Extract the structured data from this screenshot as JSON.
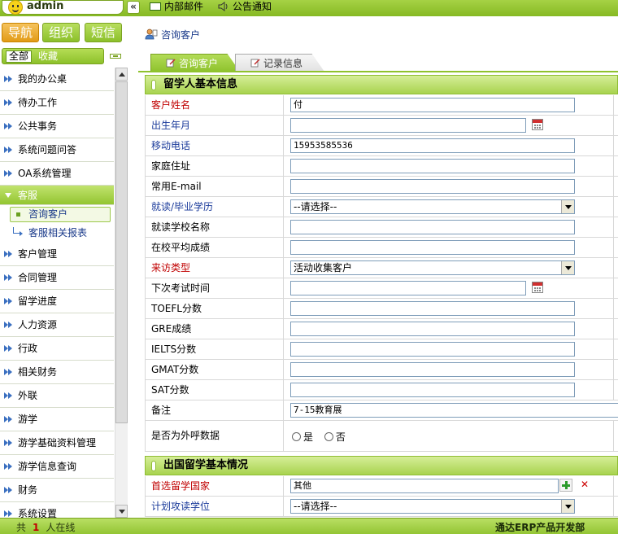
{
  "topbar": {
    "username": "admin",
    "collapse": "«",
    "mail_label": "内部邮件",
    "notice_label": "公告通知"
  },
  "sidebar": {
    "tabs": [
      "导航",
      "组织",
      "短信"
    ],
    "filter_all": "全部",
    "filter_fav": "收藏",
    "menu_top": [
      "我的办公桌",
      "待办工作",
      "公共事务",
      "系统问题问答",
      "OA系统管理"
    ],
    "open_group": "客服",
    "sub_items": [
      "咨询客户",
      "客服相关报表"
    ],
    "menu_bottom": [
      "客户管理",
      "合同管理",
      "留学进度",
      "人力资源",
      "行政",
      "相关财务",
      "外联",
      "游学",
      "游学基础资料管理",
      "游学信息查询",
      "财务",
      "系统设置"
    ]
  },
  "main": {
    "page_title": "咨询客户",
    "tabs": [
      "咨询客户",
      "记录信息"
    ],
    "section1_title": "留学人基本信息",
    "fields": [
      {
        "label": "客户姓名",
        "value": "付",
        "type": "text"
      },
      {
        "label": "出生年月",
        "value": "",
        "type": "date"
      },
      {
        "label": "移动电话",
        "value": "15953585536",
        "type": "text"
      },
      {
        "label": "家庭住址",
        "value": "",
        "type": "text"
      },
      {
        "label": "常用E-mail",
        "value": "",
        "type": "text"
      },
      {
        "label": "就读/毕业学历",
        "value": "--请选择--",
        "type": "select"
      },
      {
        "label": "就读学校名称",
        "value": "",
        "type": "text"
      },
      {
        "label": "在校平均成绩",
        "value": "",
        "type": "text"
      },
      {
        "label": "来访类型",
        "value": "活动收集客户",
        "type": "select"
      },
      {
        "label": "下次考试时间",
        "value": "",
        "type": "date"
      },
      {
        "label": "TOEFL分数",
        "value": "",
        "type": "text"
      },
      {
        "label": "GRE成绩",
        "value": "",
        "type": "text"
      },
      {
        "label": "IELTS分数",
        "value": "",
        "type": "text"
      },
      {
        "label": "GMAT分数",
        "value": "",
        "type": "text"
      },
      {
        "label": "SAT分数",
        "value": "",
        "type": "text"
      },
      {
        "label": "备注",
        "value": "7-15教育展",
        "type": "text"
      }
    ],
    "outbound_label": "是否为外呼数据",
    "radio_yes": "是",
    "radio_no": "否",
    "section2_title": "出国留学基本情况",
    "country_label": "首选留学国家",
    "country_value": "其他",
    "degree_label": "计划攻读学位",
    "degree_value": "--请选择--"
  },
  "status": {
    "prefix": "共",
    "count": "1",
    "suffix": "人在线",
    "brand": "通达ERP产品开发部"
  },
  "colors": {
    "accent_green": "#8ec22d",
    "required_red": "#c00000",
    "label_blue": "#1a3a9a"
  }
}
